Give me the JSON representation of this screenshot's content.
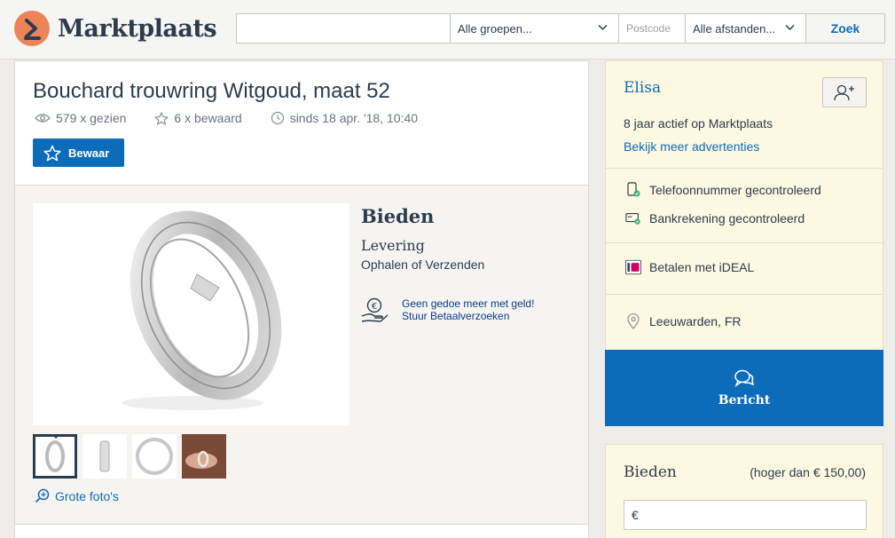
{
  "header": {
    "logo_text": "Marktplaats",
    "search": {
      "value": "",
      "placeholder": ""
    },
    "groups_select": "Alle groepen...",
    "postcode_placeholder": "Postcode",
    "distance_select": "Alle afstanden...",
    "search_button": "Zoek"
  },
  "listing": {
    "title": "Bouchard trouwring Witgoud, maat 52",
    "views": "579 x gezien",
    "saves": "6 x bewaard",
    "since": "sinds 18 apr. '18, 10:40",
    "save_button": "Bewaar",
    "price_label": "Bieden",
    "delivery_label": "Levering",
    "delivery_value": "Ophalen of Verzenden",
    "payment_promo_line1": "Geen gedoe meer met geld!",
    "payment_promo_line2": "Stuur Betaalverzoeken",
    "large_photos_link": "Grote foto's"
  },
  "seller": {
    "name": "Elisa",
    "active": "8 jaar actief op Marktplaats",
    "more_ads": "Bekijk meer advertenties",
    "phone_verified": "Telefoonnummer gecontroleerd",
    "bank_verified": "Bankrekening gecontroleerd",
    "ideal": "Betalen met iDEAL",
    "location": "Leeuwarden, FR",
    "message_button": "Bericht"
  },
  "bid": {
    "title": "Bieden",
    "minimum": "(hoger dan € 150,00)",
    "currency": "€",
    "input_value": ""
  },
  "colors": {
    "brand_blue": "#0d6cb9",
    "logo_orange": "#ed8457",
    "verified_green": "#3db17c",
    "ideal_pink": "#cc0066"
  }
}
